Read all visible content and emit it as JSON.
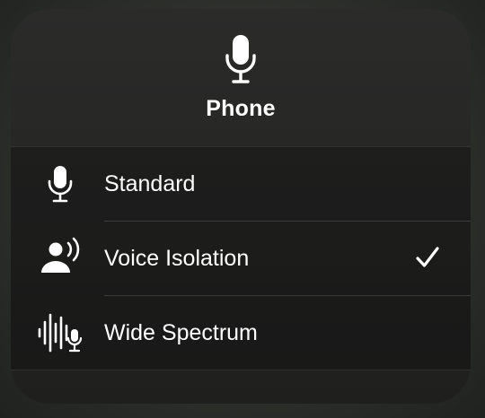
{
  "header": {
    "icon": "microphone-icon",
    "title": "Phone"
  },
  "modes": [
    {
      "label": "Standard",
      "icon": "microphone-icon",
      "selected": false
    },
    {
      "label": "Voice Isolation",
      "icon": "voice-isolation-icon",
      "selected": true
    },
    {
      "label": "Wide Spectrum",
      "icon": "wide-spectrum-icon",
      "selected": false
    }
  ],
  "colors": {
    "text": "#ffffff",
    "panel": "#262625"
  }
}
